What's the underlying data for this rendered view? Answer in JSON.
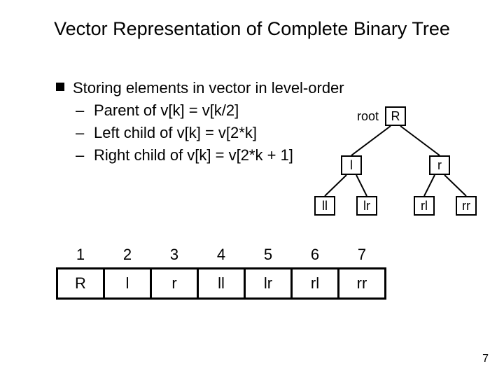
{
  "title": "Vector Representation of Complete Binary Tree",
  "bullets": {
    "main": "Storing elements in vector in level-order",
    "sub1": "Parent of v[k] = v[k/2]",
    "sub2": "Left child of v[k] = v[2*k]",
    "sub3": "Right child of v[k] = v[2*k + 1]"
  },
  "tree": {
    "root_label": "root",
    "nodes": {
      "R": "R",
      "l": "l",
      "r": "r",
      "ll": "ll",
      "lr": "lr",
      "rl": "rl",
      "rr": "rr"
    }
  },
  "array_indices": [
    "1",
    "2",
    "3",
    "4",
    "5",
    "6",
    "7"
  ],
  "array_values": [
    "R",
    "l",
    "r",
    "ll",
    "lr",
    "rl",
    "rr"
  ],
  "page_number": "7"
}
